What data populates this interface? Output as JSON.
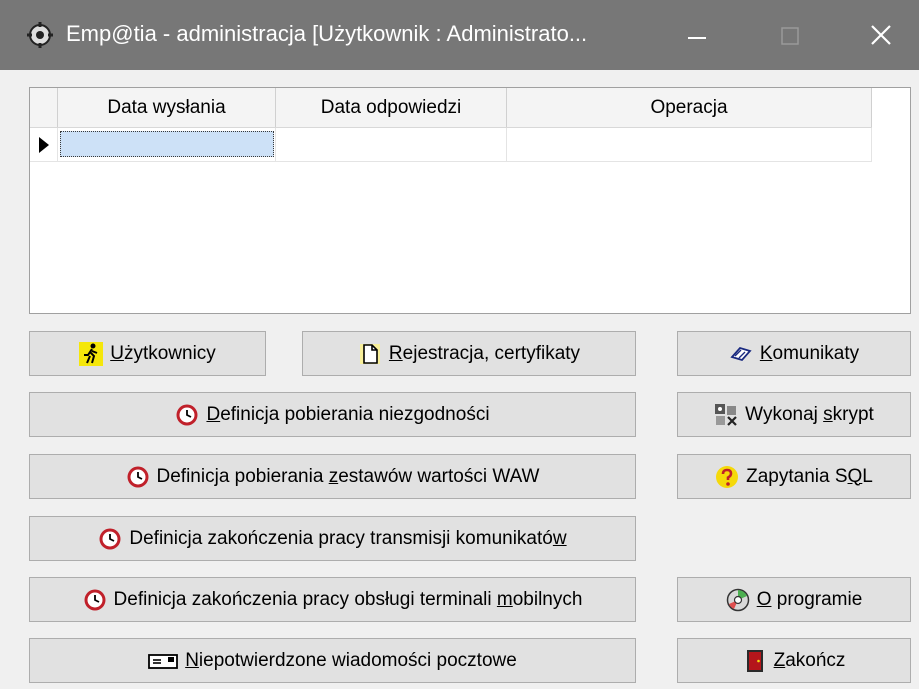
{
  "window": {
    "title": "Emp@tia - administracja  [Użytkownik : Administrato...",
    "titlebar_color": "#777777"
  },
  "grid": {
    "columns": [
      "Data wysłania",
      "Data odpowiedzi",
      "Operacja"
    ],
    "rows": [
      [
        "",
        "",
        ""
      ]
    ],
    "selection_color": "#cde1f7"
  },
  "buttons": {
    "uzytkownicy": {
      "pre": "",
      "key": "U",
      "post": "żytkownicy",
      "icon": "running-person-icon"
    },
    "rejestracja": {
      "pre": "",
      "key": "R",
      "post": "ejestracja, certyfikaty",
      "icon": "document-icon"
    },
    "komunikaty": {
      "pre": "",
      "key": "K",
      "post": "omunikaty",
      "icon": "link-icon"
    },
    "def_niezgodnosci": {
      "pre": "",
      "key": "D",
      "post": "efinicja pobierania niezgodności",
      "icon": "clock-icon"
    },
    "wykonaj_skrypt": {
      "pre": "Wykonaj ",
      "key": "s",
      "post": "krypt",
      "icon": "script-icon"
    },
    "def_waw": {
      "pre": "Definicja pobierania ",
      "key": "z",
      "post": "estawów wartości WAW",
      "icon": "clock-icon"
    },
    "zapytania_sql": {
      "pre": "Zapytania S",
      "key": "Q",
      "post": "L",
      "icon": "question-icon"
    },
    "def_transmisji": {
      "pre": "Definicja zakończenia pracy transmisji komunikató",
      "key": "w",
      "post": "",
      "icon": "clock-icon"
    },
    "def_terminali": {
      "pre": "Definicja zakończenia pracy obsługi terminali ",
      "key": "m",
      "post": "obilnych",
      "icon": "clock-icon"
    },
    "o_programie": {
      "pre": "",
      "key": "O",
      "post": " programie",
      "icon": "cd-icon"
    },
    "niepotwierdzone": {
      "pre": "",
      "key": "N",
      "post": "iepotwierdzone wiadomości pocztowe",
      "icon": "envelope-icon"
    },
    "zakoncz": {
      "pre": "",
      "key": "Z",
      "post": "akończ",
      "icon": "exit-door-icon"
    }
  },
  "colors": {
    "clock_red": "#c0202a",
    "question_yellow": "#f5d90a",
    "door_red": "#b4161b"
  }
}
